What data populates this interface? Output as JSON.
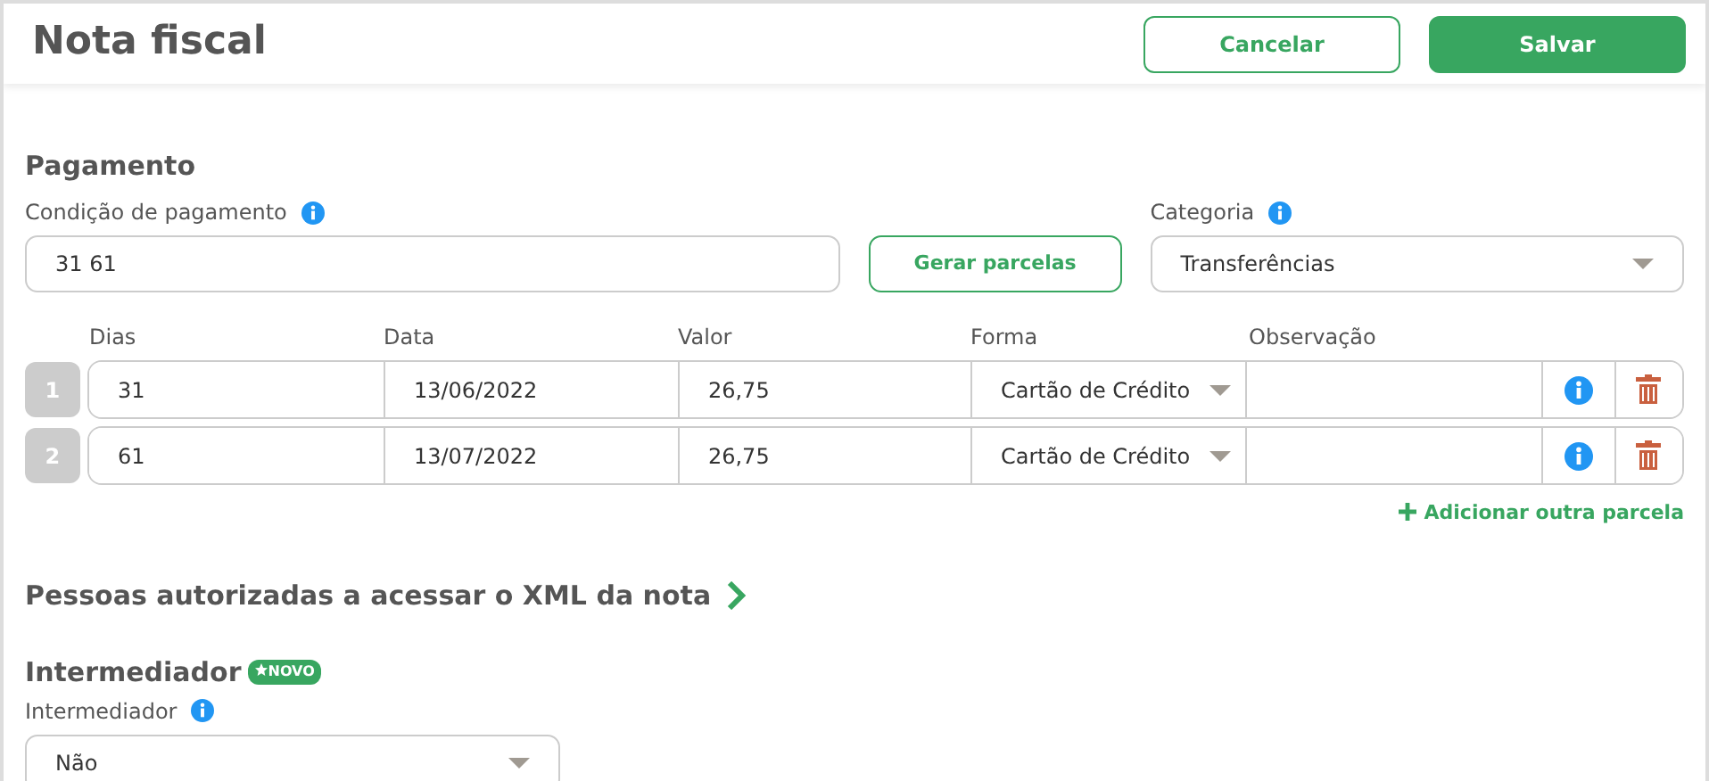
{
  "header": {
    "title": "Nota fiscal",
    "buttons": [
      {
        "label": "Cancelar",
        "kind": "outline"
      },
      {
        "label": "Salvar",
        "kind": "primary"
      }
    ]
  },
  "pagamento": {
    "title": "Pagamento",
    "condicao": {
      "label": "Condição de pagamento",
      "value": "31 61"
    },
    "generate_button": "Gerar parcelas",
    "categoria": {
      "label": "Categoria",
      "value": "Transferências"
    },
    "columns": [
      "Dias",
      "Data",
      "Valor",
      "Forma",
      "Observação"
    ],
    "rows": [
      {
        "number": "1",
        "dias": "31",
        "data": "13/06/2022",
        "valor": "26,75",
        "forma": "Cartão de Crédito"
      },
      {
        "number": "2",
        "dias": "61",
        "data": "13/07/2022",
        "valor": "26,75",
        "forma": "Cartão de Crédito"
      }
    ],
    "add_link": "Adicionar outra parcela"
  },
  "pessoas": {
    "title": "Pessoas autorizadas a acessar o XML da nota"
  },
  "intermediador": {
    "title": "Intermediador",
    "badge": "NOVO",
    "label": "Intermediador",
    "value": "Não"
  }
}
